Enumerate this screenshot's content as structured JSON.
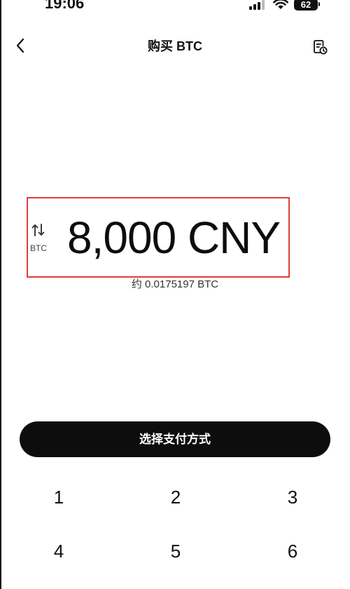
{
  "status_bar": {
    "time": "19:06",
    "battery": "62",
    "icons": [
      "signal-icon",
      "wifi-icon",
      "battery-icon"
    ]
  },
  "header": {
    "title": "购买 BTC",
    "back_icon": "chevron-left-icon",
    "history_icon": "order-history-icon"
  },
  "amount": {
    "value": "8,000 CNY",
    "toggle_label": "BTC",
    "toggle_icon": "swap-arrows-icon",
    "approx": "约 0.0175197 BTC",
    "highlight_color": "#e03c3c"
  },
  "actions": {
    "pay_label": "选择支付方式",
    "pay_color": "#0d0d0d"
  },
  "keypad": {
    "keys": [
      "1",
      "2",
      "3",
      "4",
      "5",
      "6"
    ]
  }
}
